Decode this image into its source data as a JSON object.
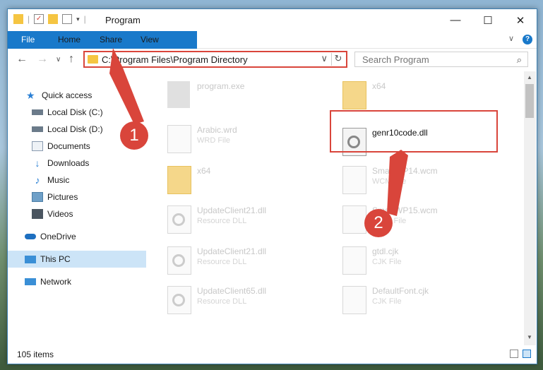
{
  "window": {
    "title": "Program",
    "buttons": {
      "minimize": "—",
      "maximize": "☐",
      "close": "✕"
    }
  },
  "ribbon": {
    "tabs": [
      "File",
      "Home",
      "Share",
      "View"
    ],
    "expand": "∨",
    "help": "?"
  },
  "nav": {
    "back": "←",
    "forward": "→",
    "recent": "∨",
    "up": "↑",
    "address": "C:\\Program Files\\Program Directory",
    "refresh": "↻",
    "search_placeholder": "Search Program",
    "search_icon": "⌕"
  },
  "sidebar": {
    "items": [
      {
        "label": "Quick access",
        "icon": "star-icon",
        "color": "#2a7fd4",
        "pinned": false
      },
      {
        "label": "Local Disk (C:)",
        "icon": "drive-icon",
        "color": "#6b7b8a",
        "pinned": true
      },
      {
        "label": "Local Disk (D:)",
        "icon": "drive-icon",
        "color": "#6b7b8a",
        "pinned": true
      },
      {
        "label": "Documents",
        "icon": "documents-icon",
        "color": "#8a9bb0",
        "pinned": true
      },
      {
        "label": "Downloads",
        "icon": "downloads-icon",
        "color": "#2a7fd4",
        "pinned": true
      },
      {
        "label": "Music",
        "icon": "music-icon",
        "color": "#2a7fd4",
        "pinned": true
      },
      {
        "label": "Pictures",
        "icon": "pictures-icon",
        "color": "#6fa0c8",
        "pinned": true
      },
      {
        "label": "Videos",
        "icon": "videos-icon",
        "color": "#4a5560",
        "pinned": true
      },
      {
        "label": "OneDrive",
        "icon": "onedrive-icon",
        "color": "#1e6fc0",
        "pinned": false
      },
      {
        "label": "This PC",
        "icon": "pc-icon",
        "color": "#3a8fd6",
        "pinned": false
      },
      {
        "label": "Network",
        "icon": "network-icon",
        "color": "#3a8fd6",
        "pinned": false
      }
    ],
    "pin_glyph": "📌"
  },
  "files": [
    {
      "name": "program.exe",
      "type": "",
      "kind": "exe"
    },
    {
      "name": "x64",
      "type": "",
      "kind": "folder"
    },
    {
      "name": "Arabic.wrd",
      "type": "WRD File",
      "kind": "file"
    },
    {
      "name": "genr10code.dll",
      "type": "",
      "kind": "dll",
      "highlight": true
    },
    {
      "name": "x64",
      "type": "",
      "kind": "folder"
    },
    {
      "name": "SmartWP14.wcm",
      "type": "WCM File",
      "kind": "file"
    },
    {
      "name": "UpdateClient21.dll",
      "type": "Resource DLL",
      "kind": "dll"
    },
    {
      "name": "SmartWP15.wcm",
      "type": "WCM File",
      "kind": "file"
    },
    {
      "name": "UpdateClient21.dll",
      "type": "Resource DLL",
      "kind": "dll"
    },
    {
      "name": "gtdl.cjk",
      "type": "CJK File",
      "kind": "file"
    },
    {
      "name": "UpdateClient65.dll",
      "type": "Resource DLL",
      "kind": "dll"
    },
    {
      "name": "DefaultFont.cjk",
      "type": "CJK File",
      "kind": "file"
    }
  ],
  "status": {
    "count": "105 items"
  },
  "callouts": [
    "1",
    "2"
  ],
  "colors": {
    "accent": "#1979ca",
    "highlight": "#d9453b",
    "selected": "#cce4f7"
  }
}
